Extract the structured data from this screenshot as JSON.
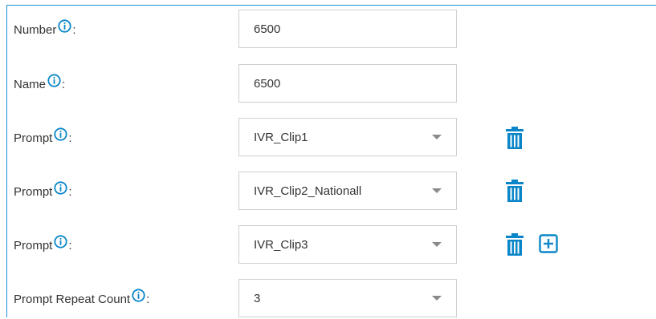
{
  "fields": [
    {
      "label": "Number",
      "value": "6500",
      "type": "text"
    },
    {
      "label": "Name",
      "value": "6500",
      "type": "text"
    },
    {
      "label": "Prompt",
      "value": "IVR_Clip1",
      "type": "select"
    },
    {
      "label": "Prompt",
      "value": "IVR_Clip2_Nationall",
      "type": "select"
    },
    {
      "label": "Prompt",
      "value": "IVR_Clip3",
      "type": "select"
    },
    {
      "label": "Prompt Repeat Count",
      "value": "3",
      "type": "select"
    }
  ],
  "colon": ":",
  "icons": {
    "info": "info-icon",
    "delete": "trash-icon",
    "add": "add-icon"
  },
  "colors": {
    "accent": "#0a86c8",
    "border": "#cfcfcf",
    "frame": "#1e90d6"
  }
}
